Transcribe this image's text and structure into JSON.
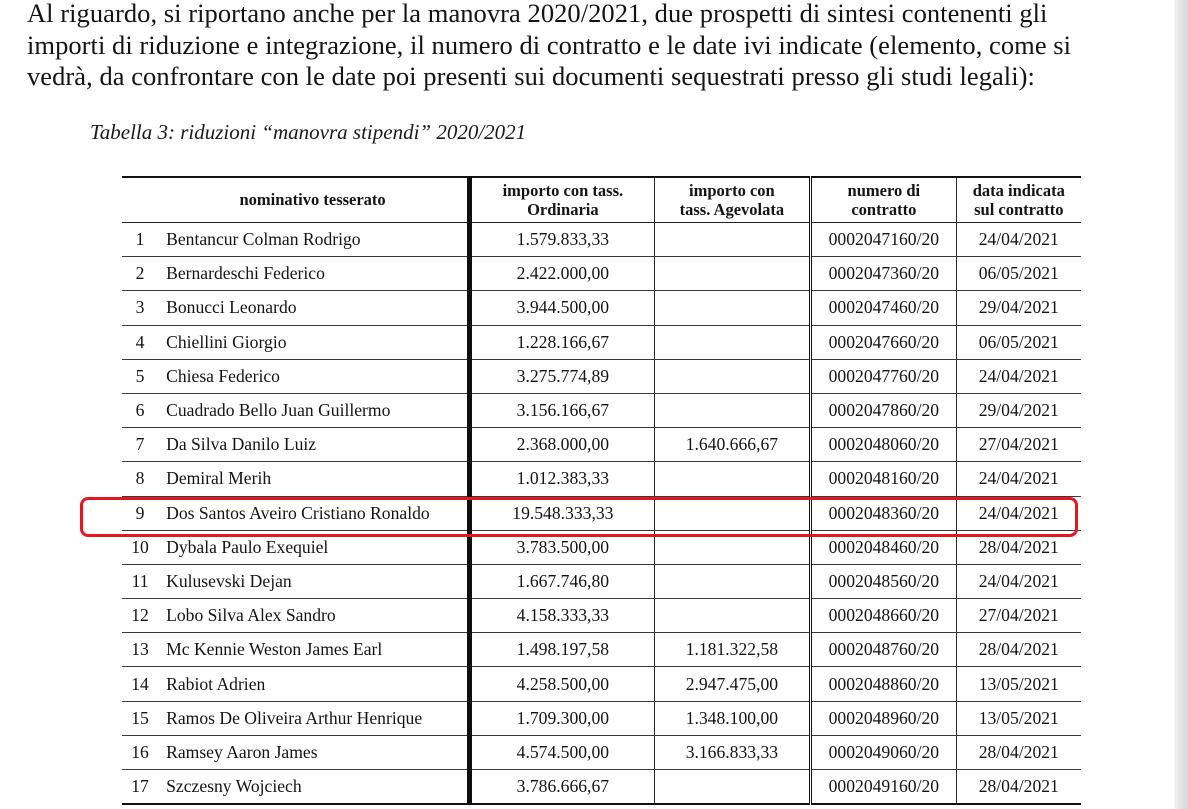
{
  "intro": {
    "lines": [
      "Al riguardo, si riportano anche per la manovra 2020/2021, due prospetti di sintesi contenenti gli",
      "importi di riduzione e integrazione, il numero di contratto e le date ivi indicate (elemento, come si",
      "vedrà, da confrontare con le date poi presenti sui documenti sequestrati presso gli studi legali):"
    ]
  },
  "table_caption": "Tabella 3: riduzioni “manovra stipendi” 2020/2021",
  "table": {
    "headers": {
      "name": "nominativo tesserato",
      "ordinaria_line1": "importo con tass.",
      "ordinaria_line2": "Ordinaria",
      "agevolata_line1": "importo con",
      "agevolata_line2": "tass. Agevolata",
      "contratto_line1": "numero di",
      "contratto_line2": "contratto",
      "data_line1": "data indicata",
      "data_line2": "sul contratto"
    },
    "rows": [
      {
        "n": "1",
        "name": "Bentancur Colman Rodrigo",
        "ordinaria": "1.579.833,33",
        "agevolata": "",
        "contratto": "0002047160/20",
        "data": "24/04/2021"
      },
      {
        "n": "2",
        "name": "Bernardeschi Federico",
        "ordinaria": "2.422.000,00",
        "agevolata": "",
        "contratto": "0002047360/20",
        "data": "06/05/2021"
      },
      {
        "n": "3",
        "name": "Bonucci Leonardo",
        "ordinaria": "3.944.500,00",
        "agevolata": "",
        "contratto": "0002047460/20",
        "data": "29/04/2021"
      },
      {
        "n": "4",
        "name": "Chiellini Giorgio",
        "ordinaria": "1.228.166,67",
        "agevolata": "",
        "contratto": "0002047660/20",
        "data": "06/05/2021"
      },
      {
        "n": "5",
        "name": "Chiesa Federico",
        "ordinaria": "3.275.774,89",
        "agevolata": "",
        "contratto": "0002047760/20",
        "data": "24/04/2021"
      },
      {
        "n": "6",
        "name": "Cuadrado Bello Juan Guillermo",
        "ordinaria": "3.156.166,67",
        "agevolata": "",
        "contratto": "0002047860/20",
        "data": "29/04/2021"
      },
      {
        "n": "7",
        "name": "Da Silva Danilo Luiz",
        "ordinaria": "2.368.000,00",
        "agevolata": "1.640.666,67",
        "contratto": "0002048060/20",
        "data": "27/04/2021"
      },
      {
        "n": "8",
        "name": "Demiral Merih",
        "ordinaria": "1.012.383,33",
        "agevolata": "",
        "contratto": "0002048160/20",
        "data": "24/04/2021"
      },
      {
        "n": "9",
        "name": "Dos Santos Aveiro Cristiano Ronaldo",
        "ordinaria": "19.548.333,33",
        "agevolata": "",
        "contratto": "0002048360/20",
        "data": "24/04/2021"
      },
      {
        "n": "10",
        "name": "Dybala Paulo Exequiel",
        "ordinaria": "3.783.500,00",
        "agevolata": "",
        "contratto": "0002048460/20",
        "data": "28/04/2021"
      },
      {
        "n": "11",
        "name": "Kulusevski Dejan",
        "ordinaria": "1.667.746,80",
        "agevolata": "",
        "contratto": "0002048560/20",
        "data": "24/04/2021"
      },
      {
        "n": "12",
        "name": "Lobo Silva Alex Sandro",
        "ordinaria": "4.158.333,33",
        "agevolata": "",
        "contratto": "0002048660/20",
        "data": "27/04/2021"
      },
      {
        "n": "13",
        "name": "Mc Kennie Weston James Earl",
        "ordinaria": "1.498.197,58",
        "agevolata": "1.181.322,58",
        "contratto": "0002048760/20",
        "data": "28/04/2021"
      },
      {
        "n": "14",
        "name": "Rabiot Adrien",
        "ordinaria": "4.258.500,00",
        "agevolata": "2.947.475,00",
        "contratto": "0002048860/20",
        "data": "13/05/2021"
      },
      {
        "n": "15",
        "name": "Ramos De Oliveira Arthur Henrique",
        "ordinaria": "1.709.300,00",
        "agevolata": "1.348.100,00",
        "contratto": "0002048960/20",
        "data": "13/05/2021"
      },
      {
        "n": "16",
        "name": "Ramsey Aaron James",
        "ordinaria": "4.574.500,00",
        "agevolata": "3.166.833,33",
        "contratto": "0002049060/20",
        "data": "28/04/2021"
      },
      {
        "n": "17",
        "name": "Szczesny Wojciech",
        "ordinaria": "3.786.666,67",
        "agevolata": "",
        "contratto": "0002049160/20",
        "data": "28/04/2021"
      }
    ]
  },
  "highlight": {
    "row_number": "9",
    "color": "#e5161e"
  }
}
